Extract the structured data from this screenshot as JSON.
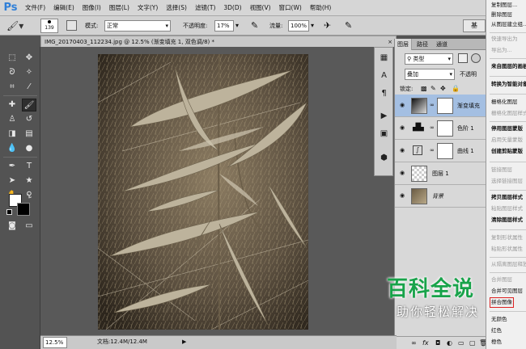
{
  "app": {
    "logo": "Ps"
  },
  "menu": [
    "文件(F)",
    "编辑(E)",
    "图像(I)",
    "图层(L)",
    "文字(Y)",
    "选择(S)",
    "滤镜(T)",
    "3D(D)",
    "视图(V)",
    "窗口(W)",
    "帮助(H)"
  ],
  "options": {
    "brush_size": "139",
    "mode_label": "模式:",
    "mode_value": "正常",
    "opacity_label": "不透明度:",
    "opacity_value": "17%",
    "flow_label": "流量:",
    "flow_value": "100%",
    "extra_button": "基"
  },
  "document": {
    "tab_title": "IMG_20170403_112234.jpg @ 12.5% (渐变填充 1, 双色调/8) *",
    "close_symbol": "×",
    "zoom": "12.5%",
    "doc_info": "文档:12.4M/12.4M"
  },
  "layers_panel": {
    "tabs": [
      "图层",
      "路径",
      "通道"
    ],
    "kind_label": "类型",
    "blend_mode": "叠加",
    "opacity_label": "不透明",
    "lock_label": "锁定:",
    "layers": [
      {
        "name": "渐变填充"
      },
      {
        "name": "色阶 1"
      },
      {
        "name": "曲线 1"
      },
      {
        "name": "图层 1"
      },
      {
        "name": "背景"
      }
    ],
    "footer_icons": [
      "link",
      "fx",
      "mask",
      "adjust",
      "folder",
      "new",
      "trash"
    ]
  },
  "context_menu": {
    "items": [
      {
        "label": "复制图层...",
        "enabled": true
      },
      {
        "label": "删除图层",
        "enabled": true
      },
      {
        "label": "从图层建立组...",
        "enabled": true
      },
      {
        "label": "快速导出为",
        "enabled": false
      },
      {
        "label": "导出为...",
        "enabled": false
      },
      {
        "label": "来自图层的画板...",
        "enabled": true,
        "bold": true
      },
      {
        "label": "转换为智能对象",
        "enabled": true,
        "bold": true
      },
      {
        "label": "栅格化图层",
        "enabled": true
      },
      {
        "label": "栅格化图层样式",
        "enabled": false
      },
      {
        "label": "停用图层蒙版",
        "enabled": true,
        "bold": true
      },
      {
        "label": "启用矢量蒙版",
        "enabled": false
      },
      {
        "label": "创建剪贴蒙版",
        "enabled": true,
        "bold": true
      },
      {
        "label": "链接图层",
        "enabled": false
      },
      {
        "label": "选择链接图层",
        "enabled": false
      },
      {
        "label": "拷贝图层样式",
        "enabled": true,
        "bold": true
      },
      {
        "label": "粘贴图层样式",
        "enabled": false
      },
      {
        "label": "清除图层样式",
        "enabled": true,
        "bold": true
      },
      {
        "label": "复制形状属性",
        "enabled": false
      },
      {
        "label": "粘贴形状属性",
        "enabled": false
      },
      {
        "label": "从隔离图层释放",
        "enabled": false
      },
      {
        "label": "合并图层",
        "enabled": false
      },
      {
        "label": "合并可见图层",
        "enabled": true
      },
      {
        "label": "拼合图像",
        "enabled": true
      },
      {
        "label": "无颜色",
        "enabled": true
      },
      {
        "label": "红色",
        "enabled": true
      },
      {
        "label": "橙色",
        "enabled": true
      }
    ]
  },
  "watermark": {
    "line1": "百科全说",
    "line2": "助你轻松解决"
  },
  "colors": {
    "accent": "#2f7fd8",
    "selected_layer": "#a4bfe2",
    "watermark_green": "#18a34a",
    "photo_tone": "#8a7a62"
  }
}
